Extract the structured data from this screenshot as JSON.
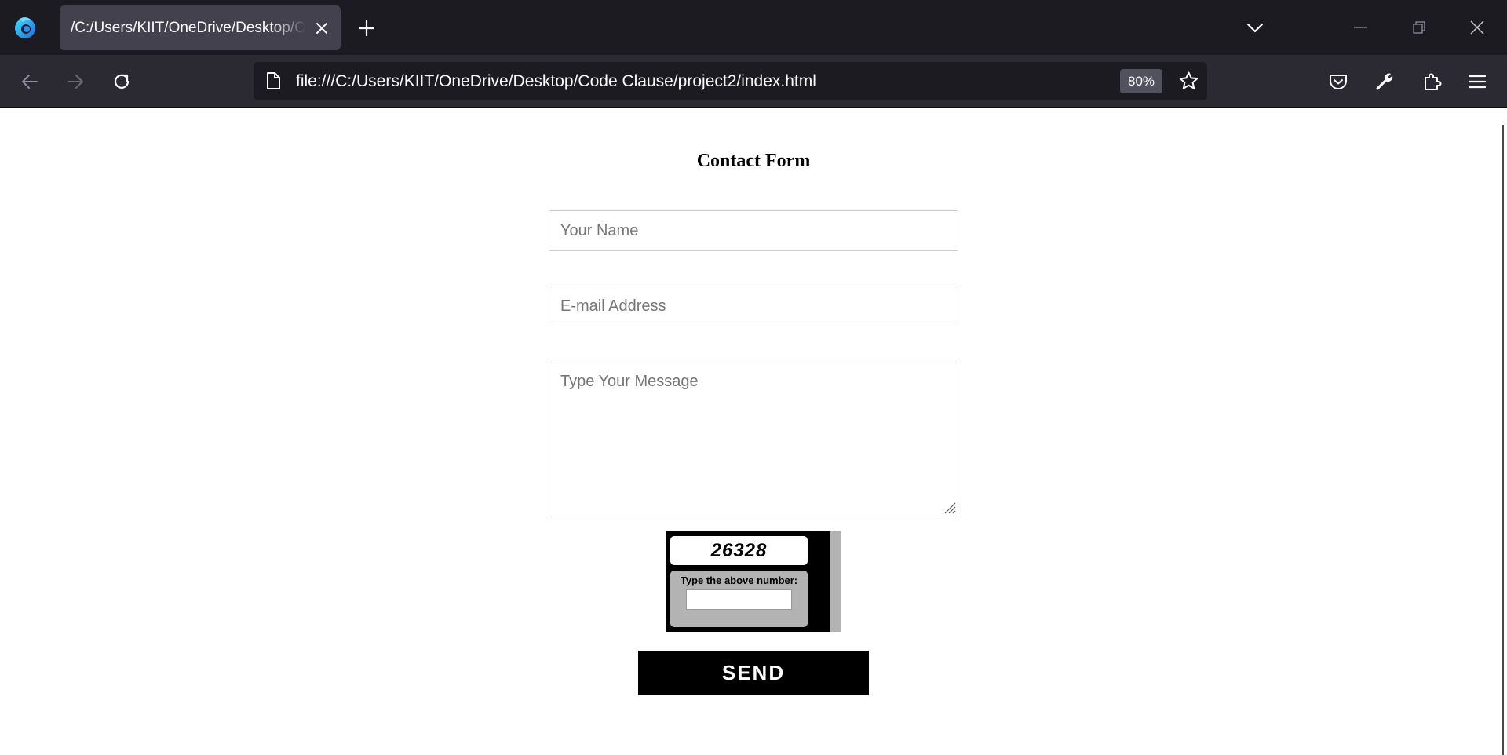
{
  "browser": {
    "tab_title": "/C:/Users/KIIT/OneDrive/Desktop/Code Clause/project2/index.html",
    "url": "file:///C:/Users/KIIT/OneDrive/Desktop/Code Clause/project2/index.html",
    "zoom": "80%",
    "icons": {
      "logo": "firefox-icon",
      "tab_close": "close-icon",
      "new_tab": "plus-icon",
      "tab_list": "chevron-down-icon",
      "back": "arrow-left-icon",
      "forward": "arrow-right-icon",
      "reload": "reload-icon",
      "page": "page-icon",
      "bookmark": "star-icon",
      "pocket": "pocket-icon",
      "tools": "wrench-icon",
      "extensions": "puzzle-icon",
      "menu": "hamburger-menu-icon",
      "minimize": "minimize-icon",
      "restore": "restore-icon",
      "window_close": "window-close-icon"
    }
  },
  "form": {
    "title": "Contact Form",
    "name_placeholder": "Your Name",
    "email_placeholder": "E-mail Address",
    "message_placeholder": "Type Your Message",
    "captcha_number": "26328",
    "captcha_label": "Type the above number:",
    "send_label": "SEND"
  },
  "colors": {
    "tabbar_bg": "#1c1b22",
    "navbar_bg": "#2b2a33",
    "active_tab_bg": "#42414d",
    "button_bg": "#000000",
    "captcha_gray": "#b3b3b3"
  }
}
